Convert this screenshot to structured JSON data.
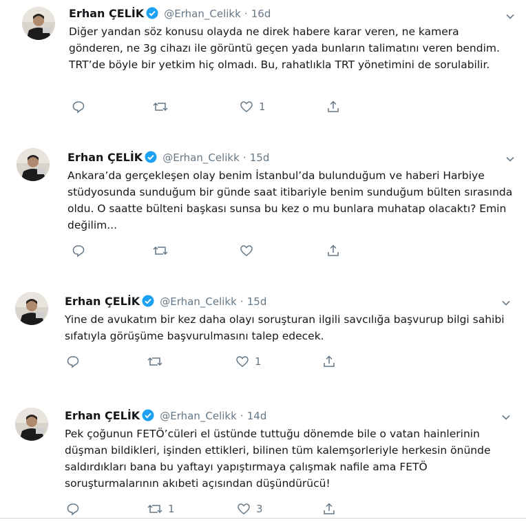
{
  "tweets": [
    {
      "name": "Erhan ÇELİK",
      "handle": "@Erhan_Celikk",
      "separator": "·",
      "time": "16d",
      "text": "Diğer yandan söz konusu olayda ne direk habere karar veren, ne kamera gönderen, ne 3g cihazı ile görüntü geçen yada bunların talimatını veren bendim. TRT’de böyle bir yetkim hiç olmadı. Bu, rahatlıkla TRT yönetimini de sorulabilir.",
      "retweets": "",
      "likes": "1"
    },
    {
      "name": "Erhan ÇELİK",
      "handle": "@Erhan_Celikk",
      "separator": "·",
      "time": "15d",
      "text": "Ankara’da gerçekleşen olay benim İstanbul’da bulunduğum ve haberi Harbiye stüdyosunda sunduğum bir günde saat itibariyle benim sunduğum bülten sırasında oldu. O saatte bülteni başkası sunsa bu kez o mu bunlara muhatap olacaktı? Emin değilim...",
      "retweets": "",
      "likes": ""
    },
    {
      "name": "Erhan ÇELİK",
      "handle": "@Erhan_Celikk",
      "separator": "·",
      "time": "15d",
      "text": "Yine de avukatım bir kez daha olayı soruşturan ilgili savcılığa başvurup bilgi sahibi sıfatıyla görüşüme başvurulmasını talep edecek.",
      "retweets": "",
      "likes": "1"
    },
    {
      "name": "Erhan ÇELİK",
      "handle": "@Erhan_Celikk",
      "separator": "·",
      "time": "14d",
      "text": "Pek çoğunun FETÖ’cüleri el üstünde tuttuğu dönemde bile o vatan hainlerinin düşman bildikleri, işinden ettikleri, bilinen tüm kalemşorleriyle herkesin önünde saldırdıkları bana bu yaftayı yapıştırmaya çalışmak nafile ama FETÖ soruşturmalarının akıbeti açısından düşündürücü!",
      "retweets": "1",
      "likes": "3"
    }
  ],
  "colors": {
    "verified": "#1da1f2",
    "secondary_text": "#657786",
    "primary_text": "#14171a"
  },
  "icons": {
    "reply": "reply-icon",
    "retweet": "retweet-icon",
    "like": "heart-icon",
    "share": "share-icon",
    "menu": "chevron-down-icon"
  }
}
